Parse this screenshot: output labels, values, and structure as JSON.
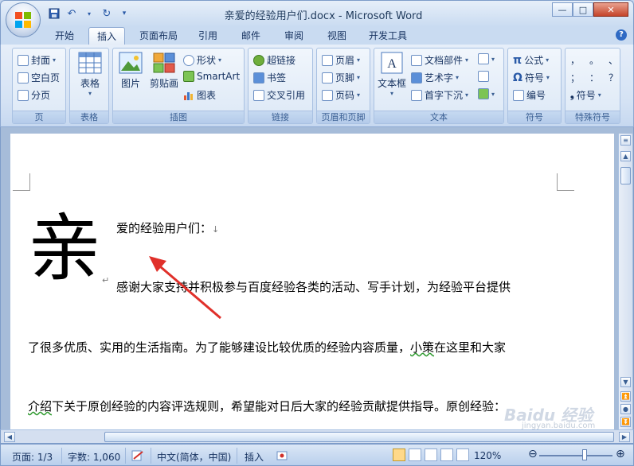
{
  "window": {
    "title": "亲爱的经验用户们.docx - Microsoft Word",
    "min_label": "—",
    "max_label": "□",
    "close_label": "✕"
  },
  "qat": {
    "save_icon": "save-icon",
    "undo_icon": "undo-icon",
    "redo_icon": "redo-icon"
  },
  "tabs": [
    {
      "label": "开始"
    },
    {
      "label": "插入",
      "active": true
    },
    {
      "label": "页面布局"
    },
    {
      "label": "引用"
    },
    {
      "label": "邮件"
    },
    {
      "label": "审阅"
    },
    {
      "label": "视图"
    },
    {
      "label": "开发工具"
    }
  ],
  "ribbon": {
    "pages": {
      "label": "页",
      "cover": "封面",
      "blank": "空白页",
      "break": "分页"
    },
    "tables": {
      "label": "表格",
      "table": "表格"
    },
    "illustrations": {
      "label": "插图",
      "picture": "图片",
      "clipart": "剪贴画",
      "shapes": "形状",
      "smartart": "SmartArt",
      "chart": "图表"
    },
    "links": {
      "label": "链接",
      "hyperlink": "超链接",
      "bookmark": "书签",
      "crossref": "交叉引用"
    },
    "headerfooter": {
      "label": "页眉和页脚",
      "header": "页眉",
      "footer": "页脚",
      "pagenum": "页码"
    },
    "text": {
      "label": "文本",
      "textbox": "文本框",
      "quickparts": "文档部件",
      "wordart": "艺术字",
      "dropcap": "首字下沉"
    },
    "symbols": {
      "label": "符号",
      "equation": "公式",
      "symbol": "符号",
      "number": "编号"
    },
    "special": {
      "label": "特殊符号",
      "c1": "，",
      "c2": "。",
      "c3": "、",
      "c4": "；",
      "c5": "：",
      "c6": "？",
      "symbol": "符号"
    }
  },
  "document": {
    "dropcap": "亲",
    "line1": "爱的经验用户们：",
    "line2": "感谢大家支持并积极参与百度经验各类的活动、写手计划，为经验平台提供",
    "line3a": "了很多优质、实用的生活指南。为了能够建设比较优质的经验内容质量，",
    "line3b": "小策",
    "line3c": "在这里和大家",
    "line4a": "介绍",
    "line4b": "下关于原创经验的内容评选规则，希望能对日后大家的经验贡献提供指导。原创经验：",
    "para_mark": "↵",
    "line_mark": "↓"
  },
  "watermark": {
    "main": "Baidu 经验",
    "sub": "jingyan.baidu.com"
  },
  "status": {
    "page": "页面: 1/3",
    "words": "字数: 1,060",
    "language": "中文(简体，中国)",
    "mode": "插入",
    "zoom": "120%"
  },
  "colors": {
    "ribbon_bg": "#d4e2f4",
    "annotation_arrow": "#e0302a",
    "page_bg": "#ffffff"
  }
}
